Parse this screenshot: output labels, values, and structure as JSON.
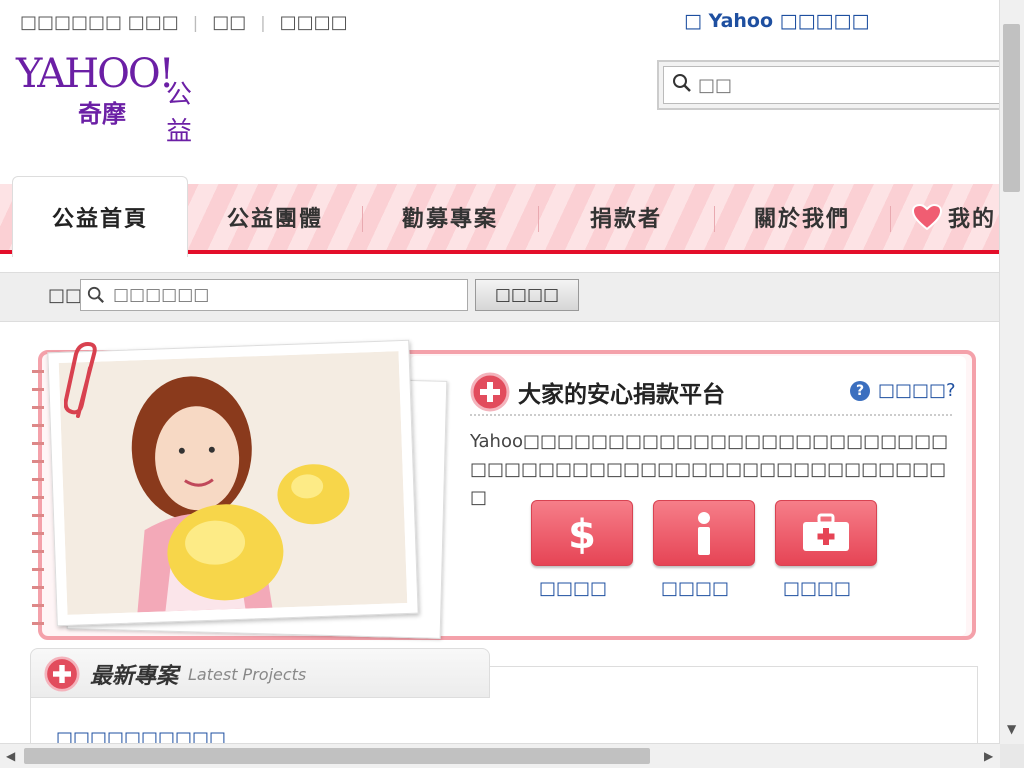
{
  "topbar": {
    "links": [
      "□□□□□□ □□□",
      "□□",
      "□□□□"
    ],
    "yahoo_link": "□ Yahoo □□□□□"
  },
  "logo": {
    "brand": "YAHOO!",
    "sub": "奇摩",
    "section": "公益"
  },
  "search": {
    "placeholder": "□□"
  },
  "nav": {
    "active": "公益首頁",
    "items": [
      "公益團體",
      "勸募專案",
      "捐款者",
      "關於我們",
      "我的"
    ]
  },
  "band": {
    "label": "□□",
    "placeholder": "□□□□□□",
    "button": "□□□□"
  },
  "hero": {
    "title": "大家的安心捐款平台",
    "help": "□□□□?",
    "text": "Yahoo□□□□□□□□□□□□□□□□□□□□□□□□□□□□□□□□□□□□□□□□□□□□□□□□□□□□□□",
    "actions": [
      {
        "icon": "dollar-icon",
        "label": "□□□□"
      },
      {
        "icon": "person-icon",
        "label": "□□□□"
      },
      {
        "icon": "first-aid-kit-icon",
        "label": "□□□□"
      }
    ]
  },
  "latest": {
    "title": "最新專案",
    "subtitle": "Latest Projects",
    "first_link": "□□□□□□□□□□"
  },
  "colors": {
    "brand": "#6b1fa5",
    "accent": "#e30e2a",
    "link": "#1e4fa0"
  }
}
